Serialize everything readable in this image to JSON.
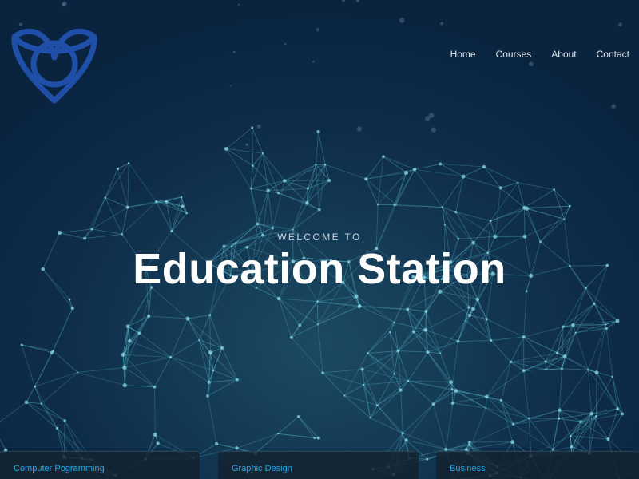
{
  "brand": {
    "logo_icon": "celtic-triquetra-logo-icon",
    "logo_color": "#1f4fa8"
  },
  "nav": {
    "items": [
      {
        "label": "Home"
      },
      {
        "label": "Courses"
      },
      {
        "label": "About"
      },
      {
        "label": "Contact"
      }
    ]
  },
  "hero": {
    "eyebrow": "WELCOME TO",
    "title": "Education Station",
    "background_icon": "network-globe-background"
  },
  "cards": [
    {
      "label": "Computer Pogramming"
    },
    {
      "label": "Graphic Design"
    },
    {
      "label": "Business"
    }
  ],
  "colors": {
    "accent": "#27a7e8",
    "background": "#0b2440",
    "network_line": "#5fc6d8"
  }
}
